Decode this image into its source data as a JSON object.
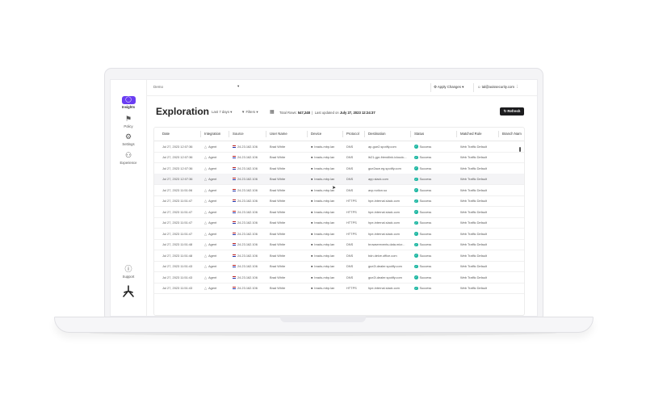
{
  "header": {
    "workspace": "Demo",
    "apply_changes": "Apply Changes",
    "user_email": "tal@axissecurity.com"
  },
  "sidebar": {
    "items": [
      {
        "label": "Insights",
        "icon": "lightbulb-icon"
      },
      {
        "label": "Policy",
        "icon": "policy-icon"
      },
      {
        "label": "Settings",
        "icon": "gear-icon"
      },
      {
        "label": "Experience",
        "icon": "users-icon"
      }
    ],
    "support": "Support"
  },
  "page": {
    "title": "Exploration",
    "range": "Last 7 days",
    "filters": "Filters",
    "total_rows_label": "Total Rows:",
    "total_rows": "547,248",
    "last_updated_label": "Last updated on",
    "last_updated": "July 27, 2023 12:24:37",
    "refresh": "Refresh"
  },
  "table": {
    "columns": [
      "Date",
      "Integration",
      "Source",
      "User Name",
      "Device",
      "Protocol",
      "Destination",
      "Status",
      "Matched Rule",
      "Branch Nam"
    ],
    "rows": [
      [
        "Jul 27, 2023 12:07:36",
        "Agent",
        "24.23.162.106",
        "Brad White",
        "brads-mbp.lan",
        "DNS",
        "ap-gue2.spotify.com",
        "Success",
        "Web Traffic Default"
      ],
      [
        "Jul 27, 2023 12:07:36",
        "Agent",
        "24.23.162.106",
        "Brad White",
        "brads-mbp.lan",
        "DNS",
        "lb21-gpr-friendlink.icloudc...",
        "Success",
        "Web Traffic Default"
      ],
      [
        "Jul 27, 2023 12:07:36",
        "Agent",
        "24.23.162.106",
        "Brad White",
        "brads-mbp.lan",
        "DNS",
        "gue2ace.eg.spotify.com",
        "Success",
        "Web Traffic Default"
      ],
      [
        "Jul 27, 2023 12:07:36",
        "Agent",
        "24.23.162.106",
        "Brad White",
        "brads-mbp.lan",
        "DNS",
        "app.slack.com",
        "Success",
        "Web Traffic Default"
      ],
      [
        "Jul 27, 2023 11:51:06",
        "Agent",
        "24.23.162.106",
        "Brad White",
        "brads-mbp.lan",
        "DNS",
        "avp.notion.so",
        "Success",
        "Web Traffic Default"
      ],
      [
        "Jul 27, 2023 11:51:47",
        "Agent",
        "24.23.162.106",
        "Brad White",
        "brads-mbp.lan",
        "HTTPS",
        "hpe-internal.slack.com",
        "Success",
        "Web Traffic Default"
      ],
      [
        "Jul 27, 2023 11:51:47",
        "Agent",
        "24.23.162.106",
        "Brad White",
        "brads-mbp.lan",
        "HTTPS",
        "hpe-internal.slack.com",
        "Success",
        "Web Traffic Default"
      ],
      [
        "Jul 27, 2023 11:51:47",
        "Agent",
        "24.23.162.106",
        "Brad White",
        "brads-mbp.lan",
        "HTTPS",
        "hpe-internal.slack.com",
        "Success",
        "Web Traffic Default"
      ],
      [
        "Jul 27, 2023 11:51:47",
        "Agent",
        "24.23.162.106",
        "Brad White",
        "brads-mbp.lan",
        "HTTPS",
        "hpe-internal.slack.com",
        "Success",
        "Web Traffic Default"
      ],
      [
        "Jul 27, 2023 11:51:48",
        "Agent",
        "24.23.162.106",
        "Brad White",
        "brads-mbp.lan",
        "DNS",
        "browserevents.data.micr...",
        "Success",
        "Web Traffic Default"
      ],
      [
        "Jul 27, 2023 11:51:48",
        "Agent",
        "24.23.162.106",
        "Brad White",
        "brads-mbp.lan",
        "DNS",
        "bdn.delve.office.com",
        "Success",
        "Web Traffic Default"
      ],
      [
        "Jul 27, 2023 11:51:43",
        "Agent",
        "24.23.162.106",
        "Brad White",
        "brads-mbp.lan",
        "DNS",
        "gue2i-dealer.spotify.com",
        "Success",
        "Web Traffic Default"
      ],
      [
        "Jul 27, 2023 11:51:43",
        "Agent",
        "24.23.162.106",
        "Brad White",
        "brads-mbp.lan",
        "DNS",
        "gue2i-dealer.spotify.com",
        "Success",
        "Web Traffic Default"
      ],
      [
        "Jul 27, 2023 11:51:43",
        "Agent",
        "24.23.162.106",
        "Brad White",
        "brads-mbp.lan",
        "HTTPS",
        "hpe-internal.slack.com",
        "Success",
        "Web Traffic Default"
      ]
    ]
  }
}
